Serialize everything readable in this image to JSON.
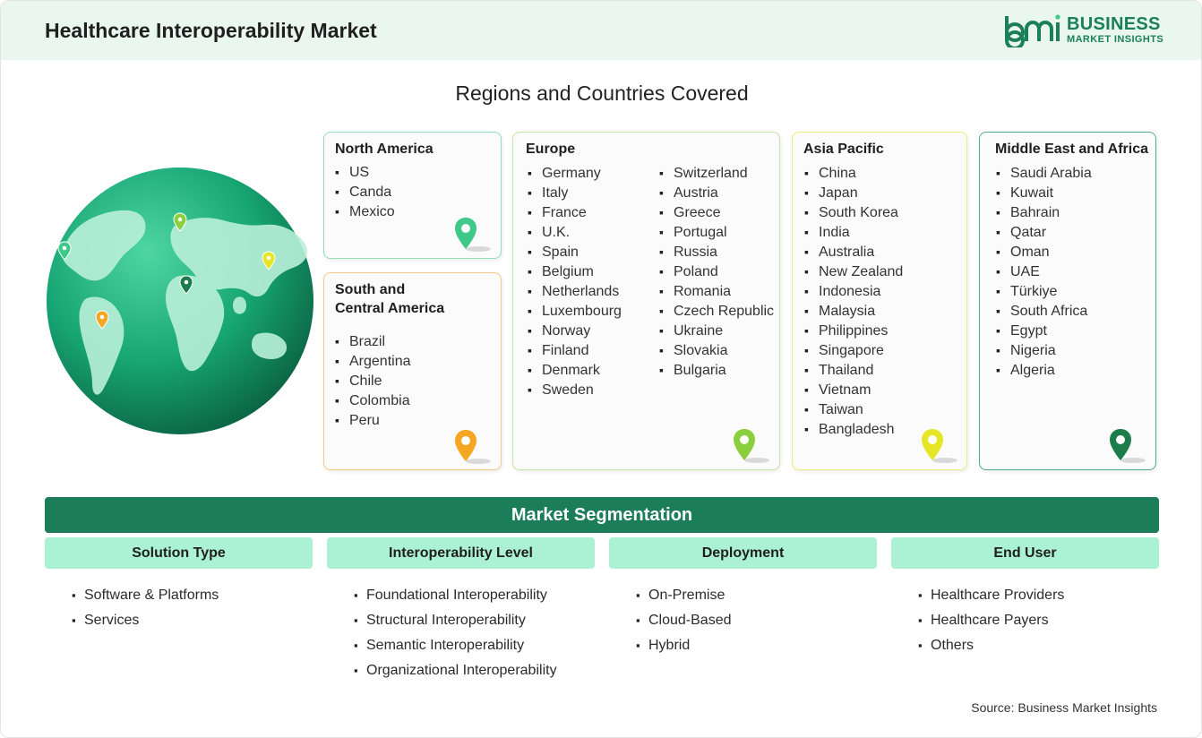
{
  "header": {
    "title": "Healthcare Interoperability Market"
  },
  "logo": {
    "mark": "bmi",
    "line1": "BUSINESS",
    "line2": "MARKET INSIGHTS"
  },
  "regions_title": "Regions and Countries Covered",
  "colors": {
    "brand": "#1c7d5b",
    "header_bg": "#e9f7ee",
    "segment_head_bg": "#abf2d5"
  },
  "regions": {
    "north_america": {
      "title": "North America",
      "items": [
        "US",
        "Canda",
        "Mexico"
      ],
      "pin_color": "#3ec98a"
    },
    "south_america": {
      "title_line1": "South and",
      "title_line2": "Central America",
      "items": [
        "Brazil",
        "Argentina",
        "Chile",
        "Colombia",
        "Peru"
      ],
      "pin_color": "#f5a623"
    },
    "europe": {
      "title": "Europe",
      "col1": [
        "Germany",
        "Italy",
        "France",
        "U.K.",
        "Spain",
        "Belgium",
        "Netherlands",
        "Luxembourg",
        "Norway",
        "Finland",
        "Denmark",
        "Sweden"
      ],
      "col2": [
        "Switzerland",
        "Austria",
        "Greece",
        "Portugal",
        "Russia",
        "Poland",
        "Romania",
        "Czech Republic",
        "Ukraine",
        "Slovakia",
        "Bulgaria"
      ],
      "pin_color": "#8ccf3e"
    },
    "asia_pacific": {
      "title": "Asia Pacific",
      "items": [
        "China",
        "Japan",
        "South Korea",
        "India",
        "Australia",
        "New Zealand",
        "Indonesia",
        "Malaysia",
        "Philippines",
        "Singapore",
        "Thailand",
        "Vietnam",
        "Taiwan",
        "Bangladesh"
      ],
      "pin_color": "#e6e627"
    },
    "mea": {
      "title": "Middle East and Africa",
      "items": [
        "Saudi Arabia",
        "Kuwait",
        "Bahrain",
        "Qatar",
        "Oman",
        "UAE",
        "Türkiye",
        "South Africa",
        "Egypt",
        "Nigeria",
        "Algeria"
      ],
      "pin_color": "#1c7d4a"
    }
  },
  "segmentation": {
    "title": "Market Segmentation",
    "columns": [
      {
        "heading": "Solution Type",
        "items": [
          "Software & Platforms",
          "Services"
        ]
      },
      {
        "heading": "Interoperability Level",
        "items": [
          "Foundational Interoperability",
          "Structural Interoperability",
          "Semantic Interoperability",
          "Organizational Interoperability"
        ]
      },
      {
        "heading": "Deployment",
        "items": [
          "On-Premise",
          "Cloud-Based",
          "Hybrid"
        ]
      },
      {
        "heading": "End User",
        "items": [
          "Healthcare Providers",
          "Healthcare Payers",
          "Others"
        ]
      }
    ]
  },
  "source": "Source: Business Market Insights"
}
